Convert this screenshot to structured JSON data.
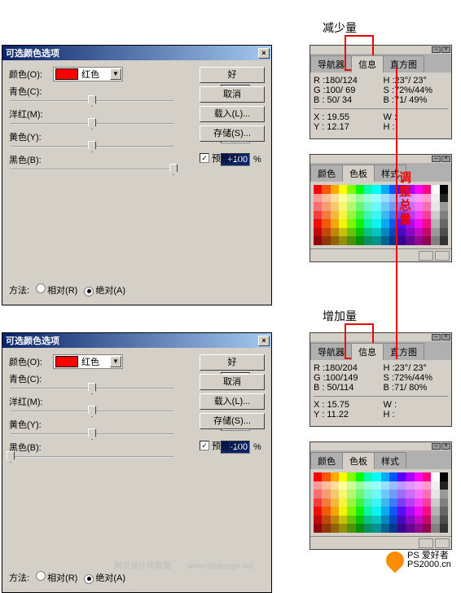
{
  "anno": {
    "decrease": "减少量",
    "increase": "增加量",
    "adjust": "调整总量"
  },
  "dialog": {
    "title": "可选颜色选项",
    "color_label": "颜色(O):",
    "color_value": "红色",
    "sliders": [
      {
        "label": "青色(C):",
        "pct": "%"
      },
      {
        "label": "洋红(M):",
        "pct": "%"
      },
      {
        "label": "黄色(Y):",
        "pct": "%"
      },
      {
        "label": "黑色(B):",
        "pct": "%"
      }
    ],
    "method_label": "方法:",
    "relative": "相对(R)",
    "absolute": "绝对(A)",
    "buttons": {
      "ok": "好",
      "cancel": "取消",
      "load": "载入(L)...",
      "save": "存储(S)..."
    },
    "preview": "预览(P)"
  },
  "top": {
    "sliders": [
      "0",
      "0",
      "0",
      "+100"
    ],
    "info": {
      "rgb": [
        "R :180/124",
        "G :100/ 69",
        "B : 50/ 34"
      ],
      "hsb": [
        "H :23°/ 23°",
        "S :72%/44%",
        "B :71/ 49%"
      ],
      "xy": [
        "X : 19.55",
        "Y : 12.17"
      ],
      "wh": [
        "W :",
        "H :"
      ]
    }
  },
  "bot": {
    "sliders": [
      "0",
      "0",
      "0",
      "-100"
    ],
    "info": {
      "rgb": [
        "R :180/204",
        "G :100/149",
        "B : 50/114"
      ],
      "hsb": [
        "H :23°/ 23°",
        "S :72%/44%",
        "B :71/ 80%"
      ],
      "xy": [
        "X : 15.75",
        "Y : 11.22"
      ],
      "wh": [
        "W :",
        "H :"
      ]
    }
  },
  "palette": {
    "tabs_info": [
      "导航器",
      "信息",
      "直方图"
    ],
    "tabs_sw": [
      "颜色",
      "色板",
      "样式"
    ]
  },
  "footer1": "网页设计师联盟",
  "footer2": "www.68design.net",
  "logo": {
    "t1": "PS 爱好者",
    "t2": "PS2000.cn"
  }
}
